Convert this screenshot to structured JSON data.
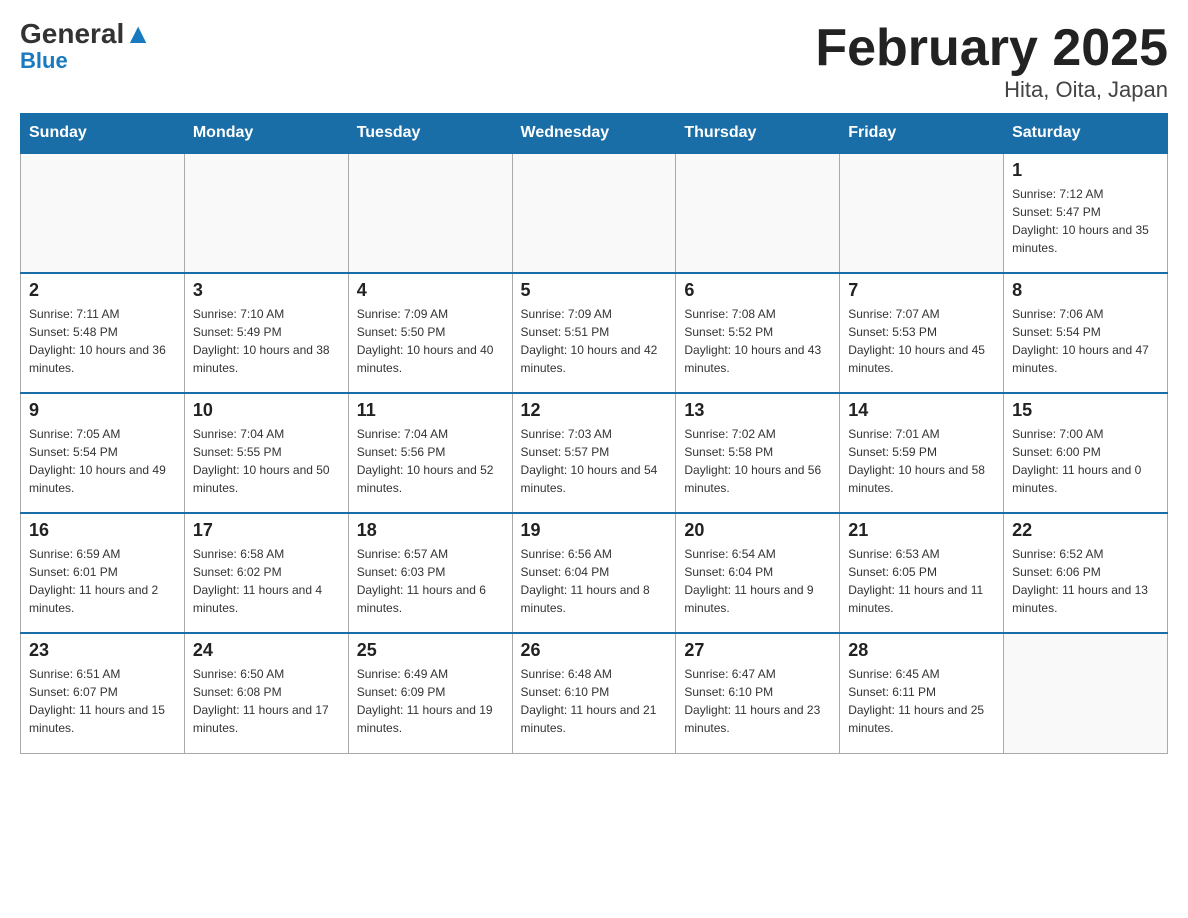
{
  "logo": {
    "general": "General",
    "blue": "Blue"
  },
  "title": "February 2025",
  "subtitle": "Hita, Oita, Japan",
  "days_of_week": [
    "Sunday",
    "Monday",
    "Tuesday",
    "Wednesday",
    "Thursday",
    "Friday",
    "Saturday"
  ],
  "weeks": [
    [
      {
        "day": null
      },
      {
        "day": null
      },
      {
        "day": null
      },
      {
        "day": null
      },
      {
        "day": null
      },
      {
        "day": null
      },
      {
        "day": 1,
        "sunrise": "7:12 AM",
        "sunset": "5:47 PM",
        "daylight": "10 hours and 35 minutes."
      }
    ],
    [
      {
        "day": 2,
        "sunrise": "7:11 AM",
        "sunset": "5:48 PM",
        "daylight": "10 hours and 36 minutes."
      },
      {
        "day": 3,
        "sunrise": "7:10 AM",
        "sunset": "5:49 PM",
        "daylight": "10 hours and 38 minutes."
      },
      {
        "day": 4,
        "sunrise": "7:09 AM",
        "sunset": "5:50 PM",
        "daylight": "10 hours and 40 minutes."
      },
      {
        "day": 5,
        "sunrise": "7:09 AM",
        "sunset": "5:51 PM",
        "daylight": "10 hours and 42 minutes."
      },
      {
        "day": 6,
        "sunrise": "7:08 AM",
        "sunset": "5:52 PM",
        "daylight": "10 hours and 43 minutes."
      },
      {
        "day": 7,
        "sunrise": "7:07 AM",
        "sunset": "5:53 PM",
        "daylight": "10 hours and 45 minutes."
      },
      {
        "day": 8,
        "sunrise": "7:06 AM",
        "sunset": "5:54 PM",
        "daylight": "10 hours and 47 minutes."
      }
    ],
    [
      {
        "day": 9,
        "sunrise": "7:05 AM",
        "sunset": "5:54 PM",
        "daylight": "10 hours and 49 minutes."
      },
      {
        "day": 10,
        "sunrise": "7:04 AM",
        "sunset": "5:55 PM",
        "daylight": "10 hours and 50 minutes."
      },
      {
        "day": 11,
        "sunrise": "7:04 AM",
        "sunset": "5:56 PM",
        "daylight": "10 hours and 52 minutes."
      },
      {
        "day": 12,
        "sunrise": "7:03 AM",
        "sunset": "5:57 PM",
        "daylight": "10 hours and 54 minutes."
      },
      {
        "day": 13,
        "sunrise": "7:02 AM",
        "sunset": "5:58 PM",
        "daylight": "10 hours and 56 minutes."
      },
      {
        "day": 14,
        "sunrise": "7:01 AM",
        "sunset": "5:59 PM",
        "daylight": "10 hours and 58 minutes."
      },
      {
        "day": 15,
        "sunrise": "7:00 AM",
        "sunset": "6:00 PM",
        "daylight": "11 hours and 0 minutes."
      }
    ],
    [
      {
        "day": 16,
        "sunrise": "6:59 AM",
        "sunset": "6:01 PM",
        "daylight": "11 hours and 2 minutes."
      },
      {
        "day": 17,
        "sunrise": "6:58 AM",
        "sunset": "6:02 PM",
        "daylight": "11 hours and 4 minutes."
      },
      {
        "day": 18,
        "sunrise": "6:57 AM",
        "sunset": "6:03 PM",
        "daylight": "11 hours and 6 minutes."
      },
      {
        "day": 19,
        "sunrise": "6:56 AM",
        "sunset": "6:04 PM",
        "daylight": "11 hours and 8 minutes."
      },
      {
        "day": 20,
        "sunrise": "6:54 AM",
        "sunset": "6:04 PM",
        "daylight": "11 hours and 9 minutes."
      },
      {
        "day": 21,
        "sunrise": "6:53 AM",
        "sunset": "6:05 PM",
        "daylight": "11 hours and 11 minutes."
      },
      {
        "day": 22,
        "sunrise": "6:52 AM",
        "sunset": "6:06 PM",
        "daylight": "11 hours and 13 minutes."
      }
    ],
    [
      {
        "day": 23,
        "sunrise": "6:51 AM",
        "sunset": "6:07 PM",
        "daylight": "11 hours and 15 minutes."
      },
      {
        "day": 24,
        "sunrise": "6:50 AM",
        "sunset": "6:08 PM",
        "daylight": "11 hours and 17 minutes."
      },
      {
        "day": 25,
        "sunrise": "6:49 AM",
        "sunset": "6:09 PM",
        "daylight": "11 hours and 19 minutes."
      },
      {
        "day": 26,
        "sunrise": "6:48 AM",
        "sunset": "6:10 PM",
        "daylight": "11 hours and 21 minutes."
      },
      {
        "day": 27,
        "sunrise": "6:47 AM",
        "sunset": "6:10 PM",
        "daylight": "11 hours and 23 minutes."
      },
      {
        "day": 28,
        "sunrise": "6:45 AM",
        "sunset": "6:11 PM",
        "daylight": "11 hours and 25 minutes."
      },
      {
        "day": null
      }
    ]
  ]
}
